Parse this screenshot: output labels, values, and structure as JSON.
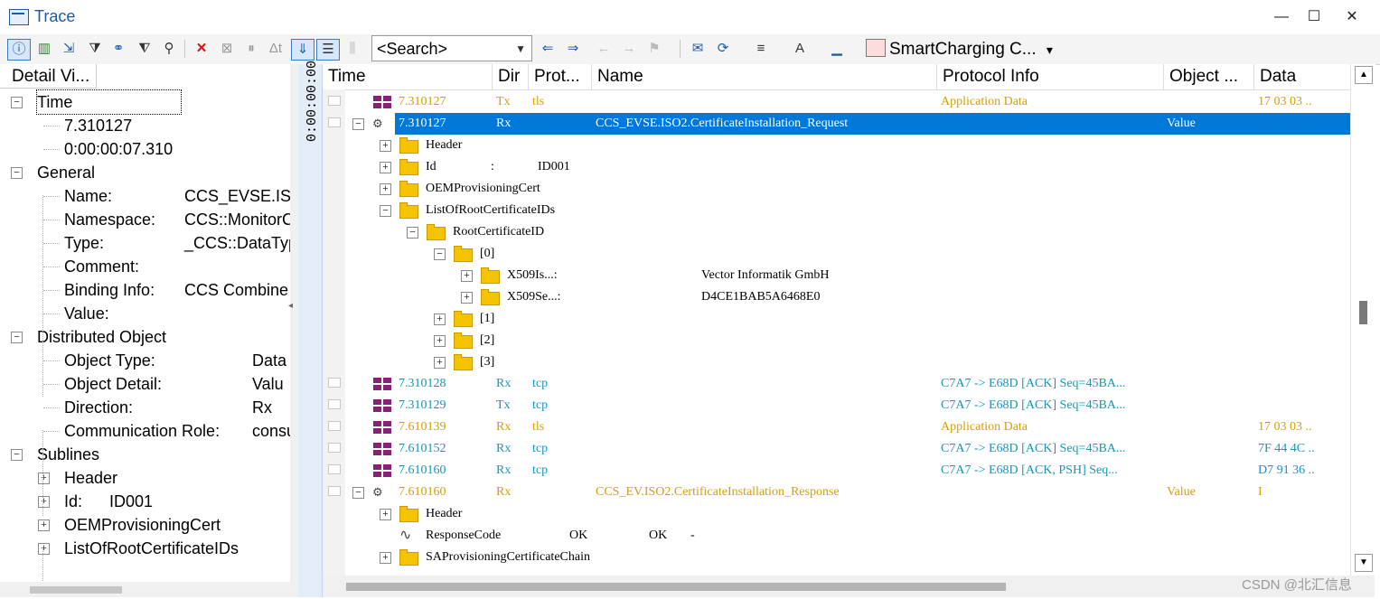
{
  "window": {
    "title": "Trace",
    "minimize": "—",
    "maximize": "☐",
    "close": "✕"
  },
  "toolbar": {
    "search_placeholder": "<Search>",
    "smart_label": "SmartCharging C...",
    "dropdown_arrow": "▾"
  },
  "detail": {
    "header": "Detail Vi...",
    "nodes": [
      {
        "label": "Time",
        "expander": "−"
      },
      {
        "label": "7.310127"
      },
      {
        "label": "0:00:00:07.310"
      },
      {
        "label": "General",
        "expander": "−"
      },
      {
        "label": "Name:",
        "value": "CCS_EVSE.ISO"
      },
      {
        "label": "Namespace:",
        "value": "CCS::MonitorC"
      },
      {
        "label": "Type:",
        "value": "_CCS::DataTyp"
      },
      {
        "label": "Comment:",
        "value": ""
      },
      {
        "label": "Binding Info:",
        "value": "CCS Combine"
      },
      {
        "label": "Value:",
        "value": ""
      },
      {
        "label": "Distributed Object",
        "expander": "−"
      },
      {
        "label": "Object Type:",
        "value": "Data"
      },
      {
        "label": "Object Detail:",
        "value": "Valu"
      },
      {
        "label": "Direction:",
        "value": "Rx"
      },
      {
        "label": "Communication Role:",
        "value": "consu"
      },
      {
        "label": "Sublines",
        "expander": "−"
      },
      {
        "label": "Header",
        "expander": "+"
      },
      {
        "label": "Id:",
        "value": "ID001",
        "expander": "+"
      },
      {
        "label": "OEMProvisioningCert",
        "expander": "+"
      },
      {
        "label": "ListOfRootCertificateIDs",
        "expander": "+"
      }
    ]
  },
  "ruler": {
    "label": "0:00:00:00"
  },
  "trace": {
    "columns": [
      "Time",
      "Dir",
      "Prot...",
      "Name",
      "Protocol Info",
      "Object ...",
      "Data"
    ],
    "rows": [
      {
        "time": "7.310127",
        "dir": "Tx",
        "prot": "tls",
        "name": "",
        "info": "Application Data",
        "obj": "",
        "data": "17 03 03  ..",
        "color": "orange"
      },
      {
        "time": "7.310127",
        "dir": "Rx",
        "prot": "",
        "name": "CCS_EVSE.ISO2.CertificateInstallation_Request",
        "info": "",
        "obj": "Value",
        "data": "",
        "selected": true
      },
      {
        "label": "Header",
        "expander": "+"
      },
      {
        "label": "Id",
        "sep": ":",
        "value": "ID001",
        "expander": "+"
      },
      {
        "label": "OEMProvisioningCert",
        "expander": "+"
      },
      {
        "label": "ListOfRootCertificateIDs",
        "expander": "−"
      },
      {
        "label": "RootCertificateID",
        "expander": "−"
      },
      {
        "label": "[0]",
        "expander": "−"
      },
      {
        "label": "X509Is...:",
        "value": "Vector Informatik GmbH",
        "expander": "+"
      },
      {
        "label": "X509Se...:",
        "value": "D4CE1BAB5A6468E0",
        "expander": "+"
      },
      {
        "label": "[1]",
        "expander": "+"
      },
      {
        "label": "[2]",
        "expander": "+"
      },
      {
        "label": "[3]",
        "expander": "+"
      },
      {
        "time": "7.310128",
        "dir": "Rx",
        "prot": "tcp",
        "name": "",
        "info": "C7A7 -> E68D [ACK] Seq=45BA...",
        "obj": "",
        "data": "",
        "color": "teal"
      },
      {
        "time": "7.310129",
        "dir": "Tx",
        "prot": "tcp",
        "name": "",
        "info": "C7A7 -> E68D [ACK] Seq=45BA...",
        "obj": "",
        "data": "",
        "color": "teal"
      },
      {
        "time": "7.610139",
        "dir": "Rx",
        "prot": "tls",
        "name": "",
        "info": "Application Data",
        "obj": "",
        "data": "17 03 03  ..",
        "color": "orange"
      },
      {
        "time": "7.610152",
        "dir": "Rx",
        "prot": "tcp",
        "name": "",
        "info": "C7A7 -> E68D [ACK] Seq=45BA...",
        "obj": "",
        "data": "7F 44 4C  ..",
        "color": "teal"
      },
      {
        "time": "7.610160",
        "dir": "Rx",
        "prot": "tcp",
        "name": "",
        "info": "C7A7 -> E68D [ACK, PSH] Seq...",
        "obj": "",
        "data": "D7 91 36  ..",
        "color": "teal"
      },
      {
        "time": "7.610160",
        "dir": "Rx",
        "prot": "",
        "name": "CCS_EV.ISO2.CertificateInstallation_Response",
        "info": "",
        "obj": "Value",
        "data": "I",
        "color": "orange"
      },
      {
        "label": "Header",
        "expander": "+"
      },
      {
        "label": "ResponseCode",
        "value": "OK",
        "value2": "OK",
        "value3": "-"
      },
      {
        "label": "SAProvisioningCertificateChain",
        "expander": "+"
      }
    ]
  },
  "watermark": "CSDN @北汇信息"
}
